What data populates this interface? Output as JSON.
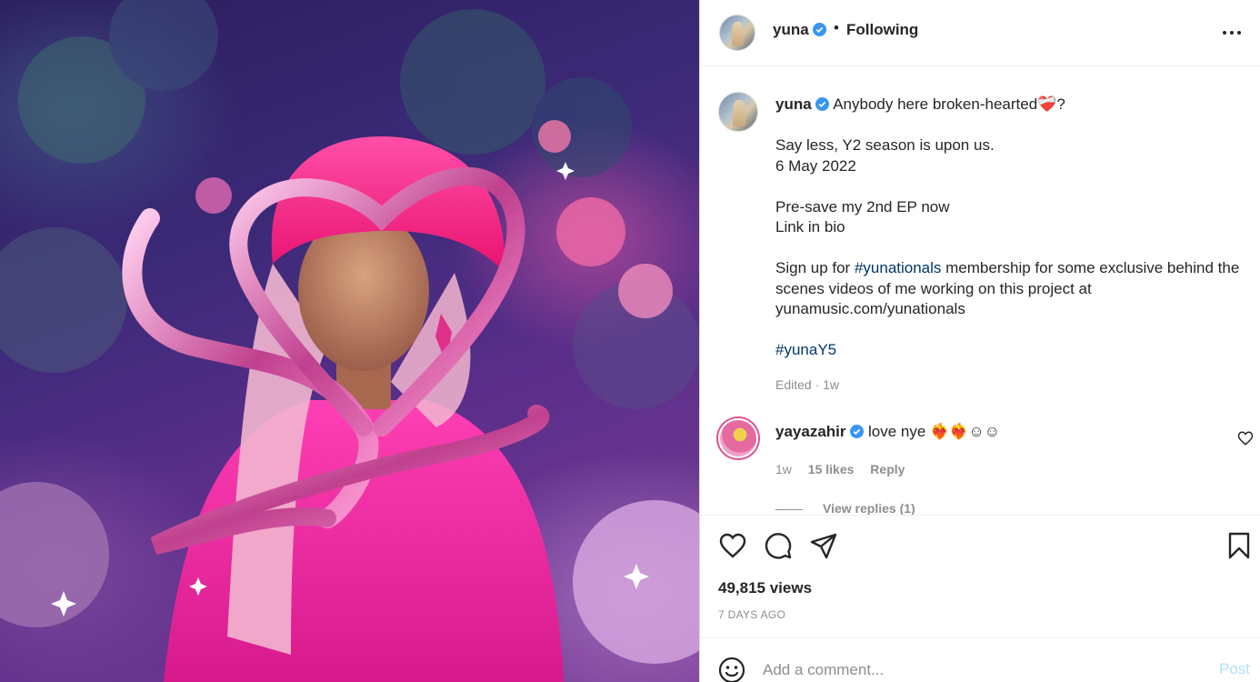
{
  "header": {
    "username": "yuna",
    "separator": "•",
    "follow_status": "Following",
    "more_icon": "more-horizontal-icon"
  },
  "caption": {
    "username": "yuna",
    "line1_text": "Anybody here broken-hearted",
    "line1_emoji": "❤️‍🩹",
    "line1_end": "?",
    "para1_line1": "Say less, Y2 season is upon us.",
    "para1_line2": "6 May 2022",
    "para2_line1": "Pre-save my 2nd EP now",
    "para2_line2": "Link in bio",
    "para3_before": "Sign up for ",
    "para3_hashtag": "#yunationals",
    "para3_after": " membership for some exclusive behind the scenes videos of me working on this project at yunamusic.com/yunationals",
    "hashtag": "#yunaY5",
    "meta": "Edited · 1w"
  },
  "comment": {
    "username": "yayazahir",
    "text": "love nye",
    "emojis": "❤️‍🔥❤️‍🔥☺☺",
    "time": "1w",
    "likes": "15 likes",
    "reply": "Reply",
    "view_replies": "View replies (1)"
  },
  "actions": {
    "like_icon": "heart-icon",
    "comment_icon": "comment-icon",
    "share_icon": "share-icon",
    "save_icon": "bookmark-icon",
    "views": "49,815 views",
    "time_ago": "7 DAYS AGO"
  },
  "add_comment": {
    "emoji_icon": "smiley-icon",
    "placeholder": "Add a comment...",
    "post_label": "Post"
  },
  "colors": {
    "link": "#00376b",
    "verified": "#3897f0",
    "post_disabled": "#b2dffc",
    "muted": "#8e8e8e"
  }
}
